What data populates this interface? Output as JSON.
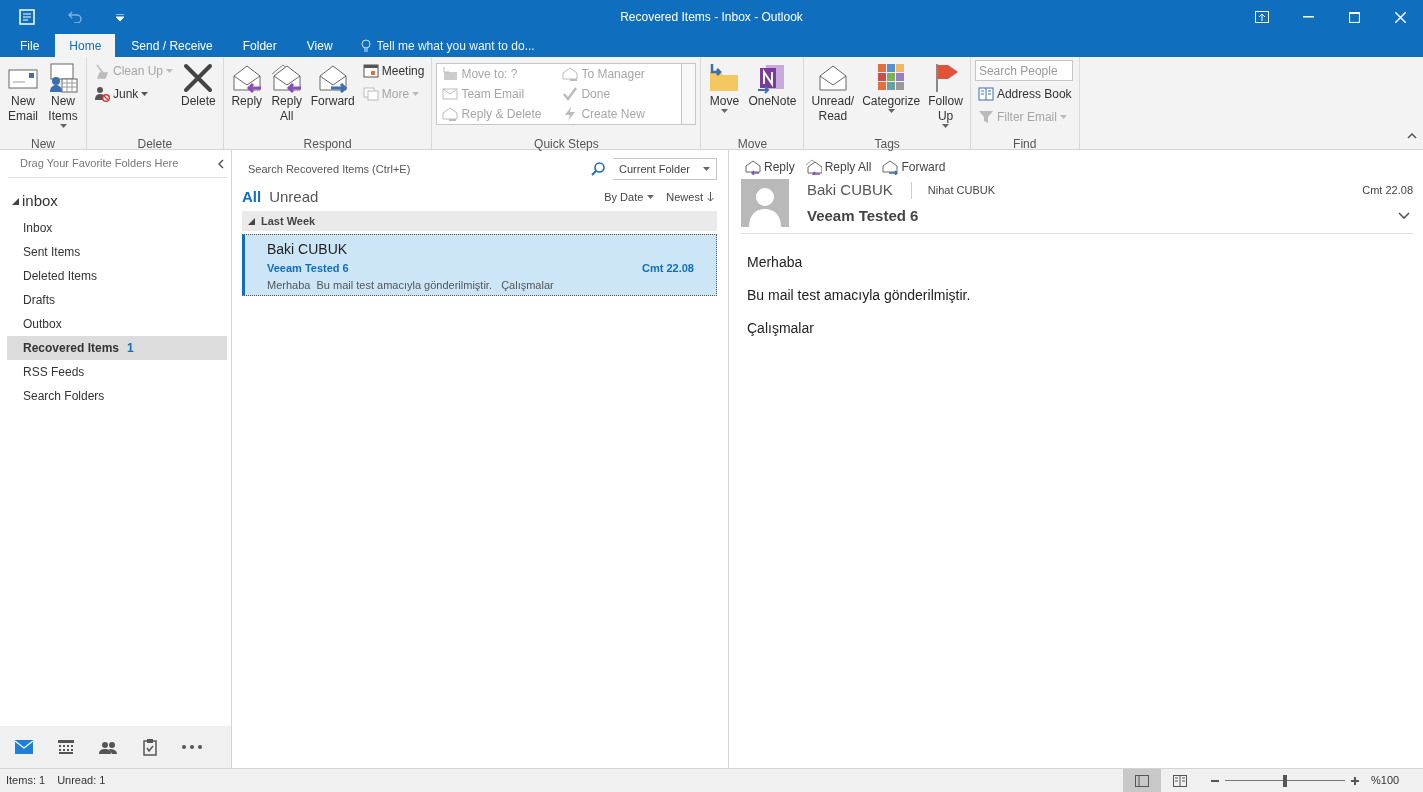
{
  "window": {
    "title": "Recovered Items - Inbox - Outlook"
  },
  "quick_access": {
    "undo": {
      "disabled": true
    }
  },
  "ribbon_tabs": [
    {
      "label": "File",
      "selected": false
    },
    {
      "label": "Home",
      "selected": true
    },
    {
      "label": "Send / Receive",
      "selected": false
    },
    {
      "label": "Folder",
      "selected": false
    },
    {
      "label": "View",
      "selected": false
    }
  ],
  "tell_me": {
    "placeholder": "Tell me what you want to do..."
  },
  "ribbon_groups": [
    {
      "label": "New",
      "kind": "buttons",
      "items": [
        {
          "kind": "large",
          "label": "New Email",
          "disabled": false,
          "dropdown": false
        },
        {
          "kind": "large",
          "label": "New Items",
          "disabled": false,
          "dropdown": true
        }
      ]
    },
    {
      "label": "Delete",
      "kind": "buttons",
      "items": [
        {
          "kind": "small",
          "label": "Clean Up",
          "disabled": true,
          "dropdown": true
        },
        {
          "kind": "small",
          "label": "Junk",
          "disabled": false,
          "dropdown": true
        },
        {
          "kind": "large",
          "label": "Delete",
          "disabled": false,
          "dropdown": false
        }
      ]
    },
    {
      "label": "Respond",
      "kind": "buttons",
      "items": [
        {
          "kind": "large",
          "label": "Reply",
          "disabled": false,
          "dropdown": false
        },
        {
          "kind": "large",
          "label": "Reply All",
          "disabled": false,
          "dropdown": false
        },
        {
          "kind": "large",
          "label": "Forward",
          "disabled": false,
          "dropdown": false
        },
        {
          "kind": "small",
          "label": "Meeting",
          "disabled": false,
          "dropdown": false
        },
        {
          "kind": "small",
          "label": "More",
          "disabled": true,
          "dropdown": true
        }
      ]
    },
    {
      "label": "Quick Steps",
      "kind": "gallery",
      "items": [
        {
          "kind": "step",
          "label": "Move to: ?",
          "disabled": true
        },
        {
          "kind": "step",
          "label": "Team Email",
          "disabled": true
        },
        {
          "kind": "step",
          "label": "Reply & Delete",
          "disabled": true
        },
        {
          "kind": "step",
          "label": "To Manager",
          "disabled": true
        },
        {
          "kind": "step",
          "label": "Done",
          "disabled": true
        },
        {
          "kind": "step",
          "label": "Create New",
          "disabled": true
        }
      ]
    },
    {
      "label": "Move",
      "kind": "buttons",
      "items": [
        {
          "kind": "large",
          "label": "Move",
          "disabled": false,
          "dropdown": true
        },
        {
          "kind": "large",
          "label": "OneNote",
          "disabled": false,
          "dropdown": false
        }
      ]
    },
    {
      "label": "Tags",
      "kind": "buttons",
      "items": [
        {
          "kind": "large",
          "label": "Unread/ Read",
          "disabled": false,
          "dropdown": false
        },
        {
          "kind": "large",
          "label": "Categorize",
          "disabled": false,
          "dropdown": true
        },
        {
          "kind": "large",
          "label": "Follow Up",
          "disabled": false,
          "dropdown": true
        }
      ]
    },
    {
      "label": "Find",
      "kind": "buttons",
      "items": [
        {
          "kind": "search",
          "placeholder": "Search People"
        },
        {
          "kind": "small",
          "label": "Address Book",
          "disabled": false,
          "dropdown": false
        },
        {
          "kind": "small",
          "label": "Filter Email",
          "disabled": true,
          "dropdown": true
        }
      ]
    }
  ],
  "folder_pane": {
    "favorites_hint": "Drag Your Favorite Folders Here",
    "account": {
      "label": "inbox",
      "expanded": true,
      "folders": [
        {
          "label": "Inbox",
          "selected": false
        },
        {
          "label": "Sent Items",
          "selected": false
        },
        {
          "label": "Deleted Items",
          "selected": false
        },
        {
          "label": "Drafts",
          "selected": false
        },
        {
          "label": "Outbox",
          "selected": false
        },
        {
          "label": "Recovered Items",
          "count": "1",
          "selected": true
        },
        {
          "label": "RSS Feeds",
          "selected": false
        },
        {
          "label": "Search Folders",
          "selected": false
        }
      ]
    }
  },
  "nav_buttons": [
    {
      "selected": true
    },
    {
      "selected": false
    },
    {
      "selected": false
    },
    {
      "selected": false
    },
    {
      "selected": false
    }
  ],
  "message_list": {
    "search": {
      "placeholder": "Search Recovered Items (Ctrl+E)"
    },
    "scope": "Current Folder",
    "filters": [
      {
        "label": "All",
        "selected": true
      },
      {
        "label": "Unread",
        "selected": false
      }
    ],
    "sort": "By Date",
    "order": "Newest",
    "groups": [
      {
        "label": "Last Week",
        "expanded": true,
        "messages": [
          {
            "sender": "Baki CUBUK",
            "subject": "Veeam Tested 6",
            "date": "Cmt 22.08",
            "preview": "Merhaba  Bu mail test amacıyla gönderilmiştir.   Çalışmalar",
            "selected": true
          }
        ]
      }
    ]
  },
  "reading_pane": {
    "actions": [
      "Reply",
      "Reply All",
      "Forward"
    ],
    "sender": "Baki CUBUK",
    "to": "Nihat CUBUK",
    "date": "Cmt 22.08",
    "subject": "Veeam Tested 6",
    "body": [
      "Merhaba",
      "Bu mail test amacıyla gönderilmiştir.",
      "Çalışmalar"
    ]
  },
  "status_bar": {
    "items": "Items: 1",
    "unread": "Unread: 1",
    "views": [
      {
        "selected": true
      },
      {
        "selected": false
      }
    ],
    "zoom": {
      "level": 0.5,
      "label": "%100"
    }
  }
}
